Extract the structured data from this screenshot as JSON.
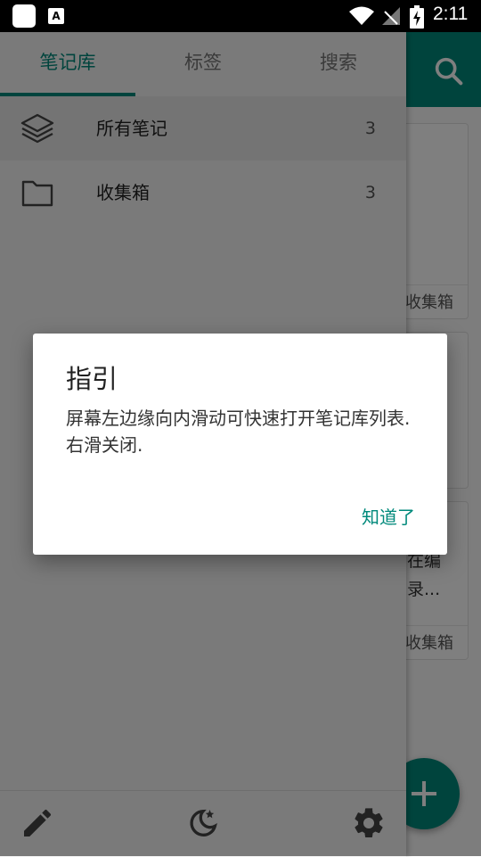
{
  "status_bar": {
    "time": "2:11",
    "notification_icons": [
      "app-notification-icon",
      "keyboard-notification-icon"
    ],
    "notification_glyph": "A"
  },
  "drawer": {
    "tabs": [
      {
        "label": "笔记库",
        "active": true
      },
      {
        "label": "标签",
        "active": false
      },
      {
        "label": "搜索",
        "active": false
      }
    ],
    "notebooks": [
      {
        "label": "所有笔记",
        "count": "3",
        "icon": "layers-icon",
        "selected": true
      },
      {
        "label": "收集箱",
        "count": "3",
        "icon": "folder-icon",
        "selected": false
      }
    ],
    "bottom_actions": [
      "edit-icon",
      "night-mode-icon",
      "settings-icon"
    ]
  },
  "background": {
    "card1_tag": "收集箱",
    "card2_text_line1": "在编",
    "card2_text_line2": "录...",
    "card2_tag": "收集箱"
  },
  "dialog": {
    "title": "指引",
    "message": "屏幕左边缘向内滑动可快速打开笔记库列表. 右滑关闭.",
    "button": "知道了"
  },
  "colors": {
    "accent": "#00897b",
    "drawer_bg": "#f5f5f5",
    "status_bar": "#000000"
  }
}
